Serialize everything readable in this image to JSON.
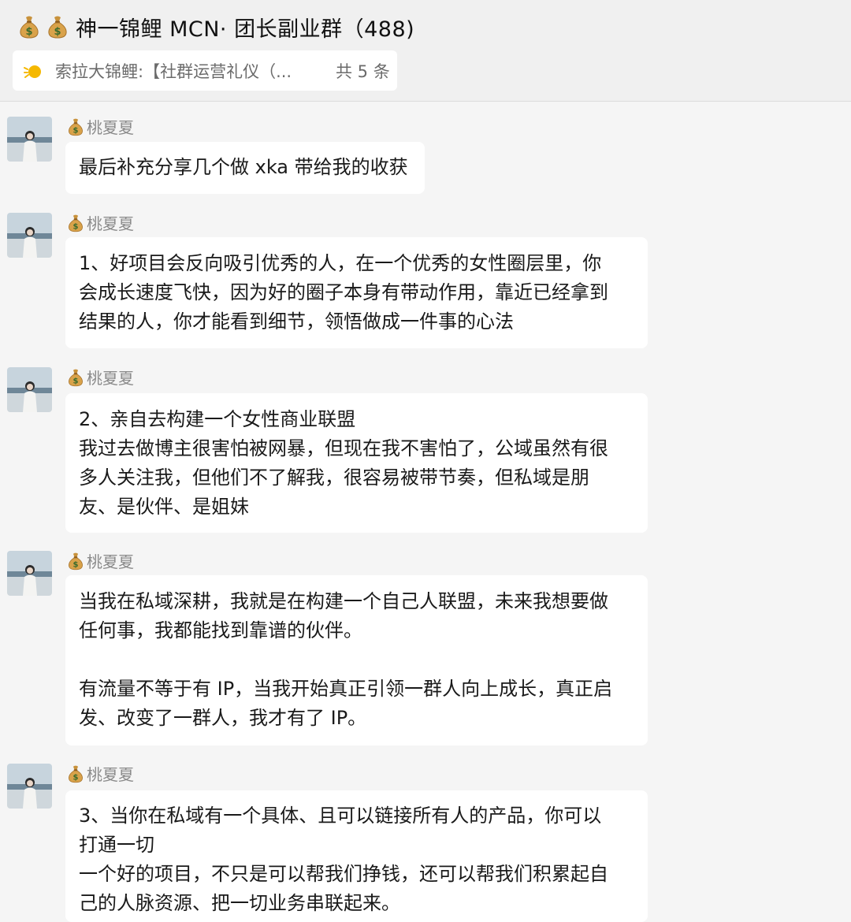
{
  "header": {
    "title": "神一锦鲤 MCN· 团长副业群（488)",
    "title_icons": [
      "moneybag-icon",
      "moneybag-icon"
    ],
    "pinned": {
      "text": "索拉大锦鲤:【社群运营礼仪（...",
      "count": "共 5 条",
      "icon": "pin-bulb-icon"
    }
  },
  "messages": [
    {
      "sender": "桃夏夏",
      "lines": [
        "最后补充分享几个做 xka 带给我的收获"
      ]
    },
    {
      "sender": "桃夏夏",
      "lines": [
        "1、好项目会反向吸引优秀的人，在一个优秀的女性圈层里，你",
        "会成长速度飞快，因为好的圈子本身有带动作用，靠近已经拿到",
        "结果的人，你才能看到细节，领悟做成一件事的心法"
      ]
    },
    {
      "sender": "桃夏夏",
      "lines": [
        "2、亲自去构建一个女性商业联盟",
        "我过去做博主很害怕被网暴，但现在我不害怕了，公域虽然有很",
        "多人关注我，但他们不了解我，很容易被带节奏，但私域是朋",
        "友、是伙伴、是姐妹"
      ]
    },
    {
      "sender": "桃夏夏",
      "lines": [
        "当我在私域深耕，我就是在构建一个自己人联盟，未来我想要做",
        "任何事，我都能找到靠谱的伙伴。",
        "有流量不等于有 IP，当我开始真正引领一群人向上成长，真正启",
        "发、改变了一群人，我才有了 IP。"
      ]
    },
    {
      "sender": "桃夏夏",
      "lines": [
        "3、当你在私域有一个具体、且可以链接所有人的产品，你可以",
        "打通一切",
        "一个好的项目，不只是可以帮我们挣钱，还可以帮我们积累起自",
        "己的人脉资源、把一切业务串联起来。"
      ]
    }
  ]
}
